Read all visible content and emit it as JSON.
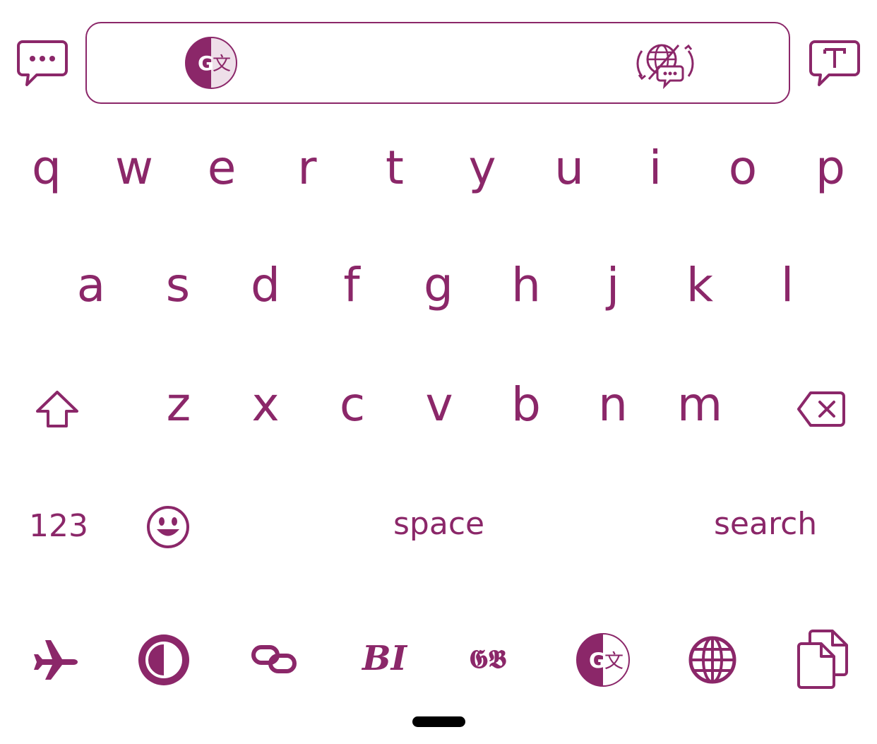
{
  "colors": {
    "accent": "#8b2769",
    "background": "#ffffff"
  },
  "toolbar": {
    "left_icon": "chat-bubble-dots-icon",
    "right_icon": "text-bubble-icon",
    "center_icons": [
      "google-translate-icon",
      "globe-chat-translate-icon"
    ]
  },
  "keyboard": {
    "row1": [
      "q",
      "w",
      "e",
      "r",
      "t",
      "y",
      "u",
      "i",
      "o",
      "p"
    ],
    "row2": [
      "a",
      "s",
      "d",
      "f",
      "g",
      "h",
      "j",
      "k",
      "l"
    ],
    "row3": [
      "z",
      "x",
      "c",
      "v",
      "b",
      "n",
      "m"
    ],
    "numbers_label": "123",
    "space_label": "space",
    "action_label": "search"
  },
  "bottom_toolbar": {
    "icons": [
      "airplane-icon",
      "contrast-icon",
      "link-icon",
      "bold-italic-icon",
      "gothic-font-icon",
      "google-translate-icon",
      "globe-icon",
      "copy-icon"
    ],
    "bold_italic_text": "BI",
    "gothic_text": "𝕲𝕭"
  }
}
